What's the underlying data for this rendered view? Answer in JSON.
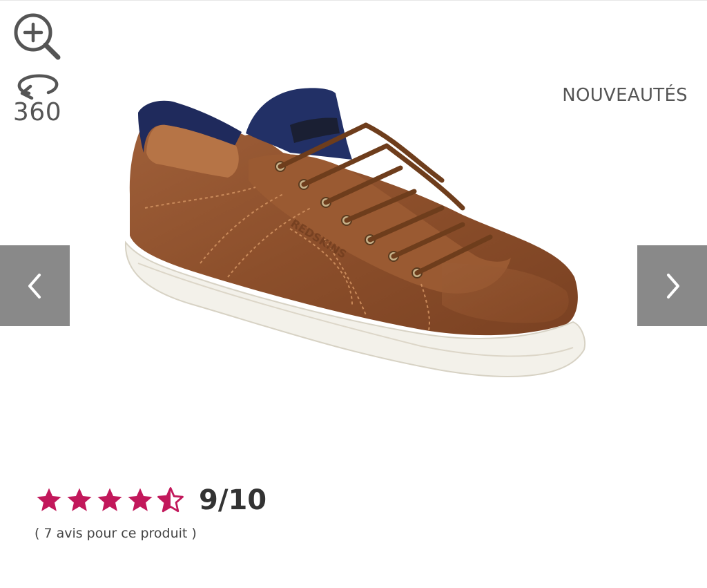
{
  "toolbar": {
    "zoom_icon": "zoom-in-icon",
    "rotate_icon": "rotate-360-icon",
    "rotate_label": "360"
  },
  "badge": {
    "label": "NOUVEAUTÉS"
  },
  "gallery": {
    "prev_icon": "chevron-left-icon",
    "next_icon": "chevron-right-icon"
  },
  "rating": {
    "score_label": "9/10",
    "stars_value": 4.5,
    "stars_max": 5,
    "star_color": "#c2185b",
    "reviews_label": "( 7 avis pour ce produit )"
  },
  "colors": {
    "nav_background": "#898989",
    "text_gray": "#555555"
  }
}
